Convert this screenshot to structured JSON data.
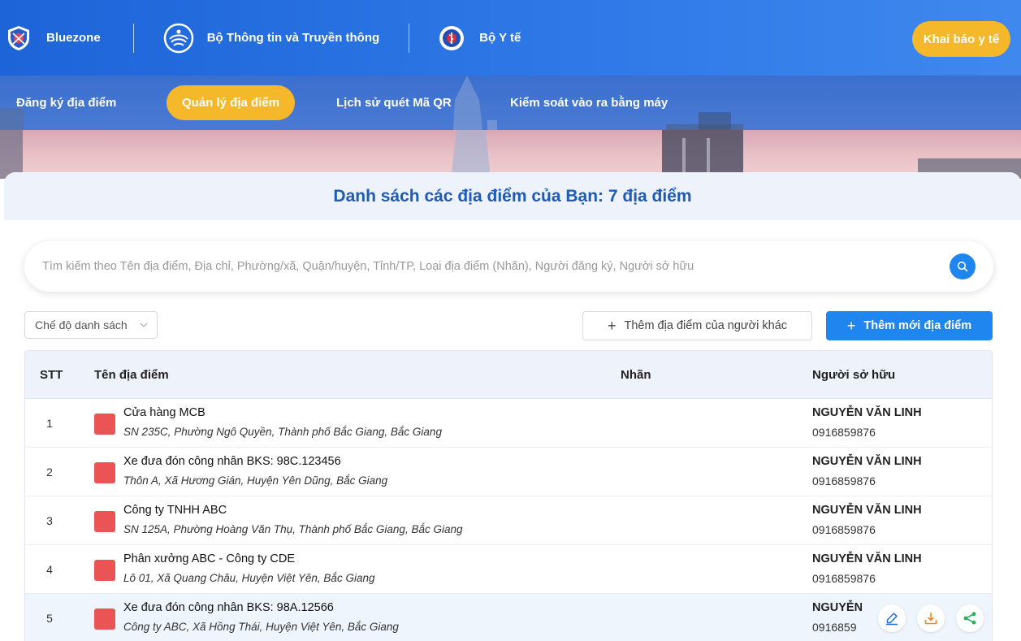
{
  "header": {
    "brands": [
      {
        "label": "Bluezone",
        "icon": "bluezone-shield-icon"
      },
      {
        "label": "Bộ Thông tin và Truyền thông",
        "icon": "ministry-info-comm-logo-icon"
      },
      {
        "label": "Bộ Y tế",
        "icon": "ministry-health-logo-icon"
      }
    ],
    "declare_button": "Khai báo y tế"
  },
  "nav": {
    "items": [
      {
        "label": "Đăng ký địa điểm",
        "active": false
      },
      {
        "label": "Quản lý địa điểm",
        "active": true
      },
      {
        "label": "Lịch sử quét Mã QR",
        "active": false
      },
      {
        "label": "Kiểm soát vào ra bằng máy",
        "active": false
      }
    ]
  },
  "page": {
    "title": "Danh sách các địa điểm của Bạn: 7 địa điểm"
  },
  "search": {
    "placeholder": "Tìm kiếm theo Tên địa điểm, Địa chỉ, Phường/xã, Quận/huyện, Tỉnh/TP, Loại địa điểm (Nhãn), Người đăng ký, Người sở hữu",
    "icon": "search-icon"
  },
  "toolbar": {
    "view_mode": "Chế độ danh sách",
    "add_other_label": "Thêm địa điểm của người khác",
    "add_new_label": "Thêm mới địa điểm"
  },
  "table": {
    "columns": [
      "STT",
      "Tên địa điểm",
      "Nhãn",
      "Người sở hữu"
    ],
    "rows": [
      {
        "stt": "1",
        "name": "Cửa hàng MCB",
        "address": "SN 235C, Phường Ngô Quyền, Thành phố Bắc Giang, Bắc Giang",
        "owner": "NGUYỄN VĂN LINH",
        "phone": "0916859876",
        "color": "#ea5455"
      },
      {
        "stt": "2",
        "name": "Xe đưa đón công nhân BKS: 98C.123456",
        "address": "Thôn A, Xã Hương Gián, Huyện Yên Dũng, Bắc Giang",
        "owner": "NGUYỄN VĂN LINH",
        "phone": "0916859876",
        "color": "#ea5455"
      },
      {
        "stt": "3",
        "name": "Công ty TNHH ABC",
        "address": "SN 125A, Phường Hoàng Văn Thụ, Thành phố Bắc Giang, Bắc Giang",
        "owner": "NGUYỄN VĂN LINH",
        "phone": "0916859876",
        "color": "#ea5455"
      },
      {
        "stt": "4",
        "name": "Phân xưởng ABC - Công ty CDE",
        "address": "Lô 01, Xã Quang Châu, Huyện Việt Yên, Bắc Giang",
        "owner": "NGUYỄN VĂN LINH",
        "phone": "0916859876",
        "color": "#ea5455"
      },
      {
        "stt": "5",
        "name": "Xe đưa đón công nhân BKS: 98A.12566",
        "address": "Công ty ABC, Xã Hồng Thái, Huyện Việt Yên, Bắc Giang",
        "owner": "NGUYỄN",
        "phone": "0916859",
        "color": "#ea5455"
      }
    ]
  },
  "row_actions": [
    "edit-icon",
    "download-icon",
    "share-icon"
  ],
  "colors": {
    "primary": "#1f86f0",
    "accent": "#f5b82a",
    "title": "#1d5bb8",
    "swatch": "#ea5455"
  }
}
